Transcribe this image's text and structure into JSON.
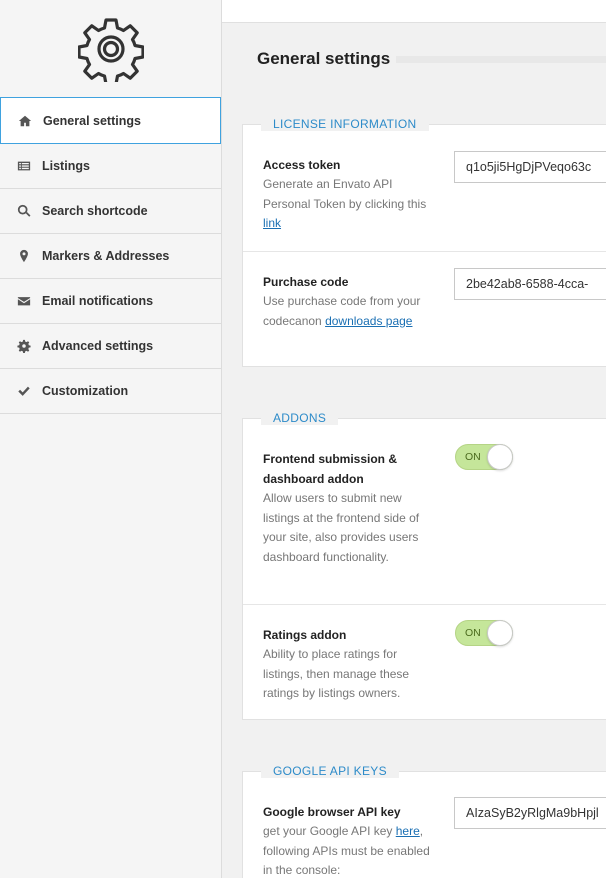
{
  "sidebar": {
    "items": [
      {
        "label": "General settings",
        "icon": "home-icon"
      },
      {
        "label": "Listings",
        "icon": "list-icon"
      },
      {
        "label": "Search shortcode",
        "icon": "search-icon"
      },
      {
        "label": "Markers & Addresses",
        "icon": "map-marker-icon"
      },
      {
        "label": "Email notifications",
        "icon": "envelope-icon"
      },
      {
        "label": "Advanced settings",
        "icon": "gear-icon"
      },
      {
        "label": "Customization",
        "icon": "check-icon"
      }
    ]
  },
  "main": {
    "title": "General settings",
    "sections": {
      "license": {
        "legend": "LICENSE INFORMATION",
        "access_token": {
          "label": "Access token",
          "desc_prefix": "Generate an Envato API Personal Token by clicking this ",
          "link": "link",
          "value": "q1o5ji5HgDjPVeqo63c"
        },
        "purchase_code": {
          "label": "Purchase code",
          "desc_prefix": "Use purchase code from your codecanon ",
          "link": "downloads page",
          "value": "2be42ab8-6588-4cca-"
        }
      },
      "addons": {
        "legend": "ADDONS",
        "frontend": {
          "label": "Frontend submission & dashboard addon",
          "desc": "Allow users to submit new listings at the frontend side of your site, also provides users dashboard functionality.",
          "toggle": "ON"
        },
        "ratings": {
          "label": "Ratings addon",
          "desc": "Ability to place ratings for listings, then manage these ratings by listings owners.",
          "toggle": "ON"
        }
      },
      "google": {
        "legend": "GOOGLE API KEYS",
        "browser_key": {
          "label": "Google browser API key",
          "desc_prefix": "get your Google API key ",
          "link": "here",
          "desc_suffix": ", following APIs must be enabled in the console:",
          "value": "AIzaSyB2yRlgMa9bHpjl"
        }
      }
    }
  },
  "colors": {
    "accent": "#2d8bc9",
    "active_border": "#3fa2df",
    "toggle_on": "#c5e69a"
  }
}
